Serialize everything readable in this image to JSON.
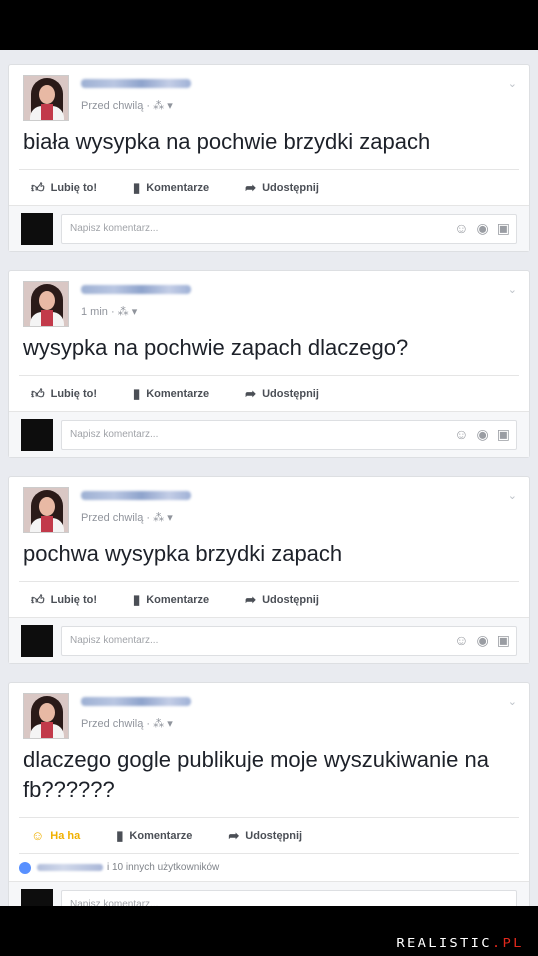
{
  "actions": {
    "like": "Lubię to!",
    "comment": "Komentarze",
    "share": "Udostępnij",
    "haha": "Ha ha"
  },
  "comment_placeholder": "Napisz komentarz...",
  "posts": [
    {
      "time": "Przed chwilą · ⁂ ▾",
      "text": "biała wysypka na pochwie brzydki zapach"
    },
    {
      "time": "1 min · ⁂ ▾",
      "text": "wysypka na pochwie zapach dlaczego?"
    },
    {
      "time": "Przed chwilą · ⁂ ▾",
      "text": "pochwa wysypka brzydki zapach"
    },
    {
      "time": "Przed chwilą · ⁂ ▾",
      "text": "dlaczego gogle publikuje moje wyszukiwanie na fb??????",
      "likes_text": "i 10 innych użytkowników"
    }
  ],
  "watermark": {
    "main": "REALISTIC",
    "suffix": ".PL",
    "suffix_color": "#e0281c"
  },
  "colors": {
    "like_blue": "#5890ff",
    "haha_yellow": "#f0b000",
    "text": "#1d2129",
    "meta": "#90949c"
  },
  "icons": [
    "thumb-up-icon",
    "comment-icon",
    "share-arrow-icon",
    "emoji-icon",
    "camera-icon",
    "sticker-icon",
    "chevron-down-icon",
    "haha-emoji-icon"
  ]
}
